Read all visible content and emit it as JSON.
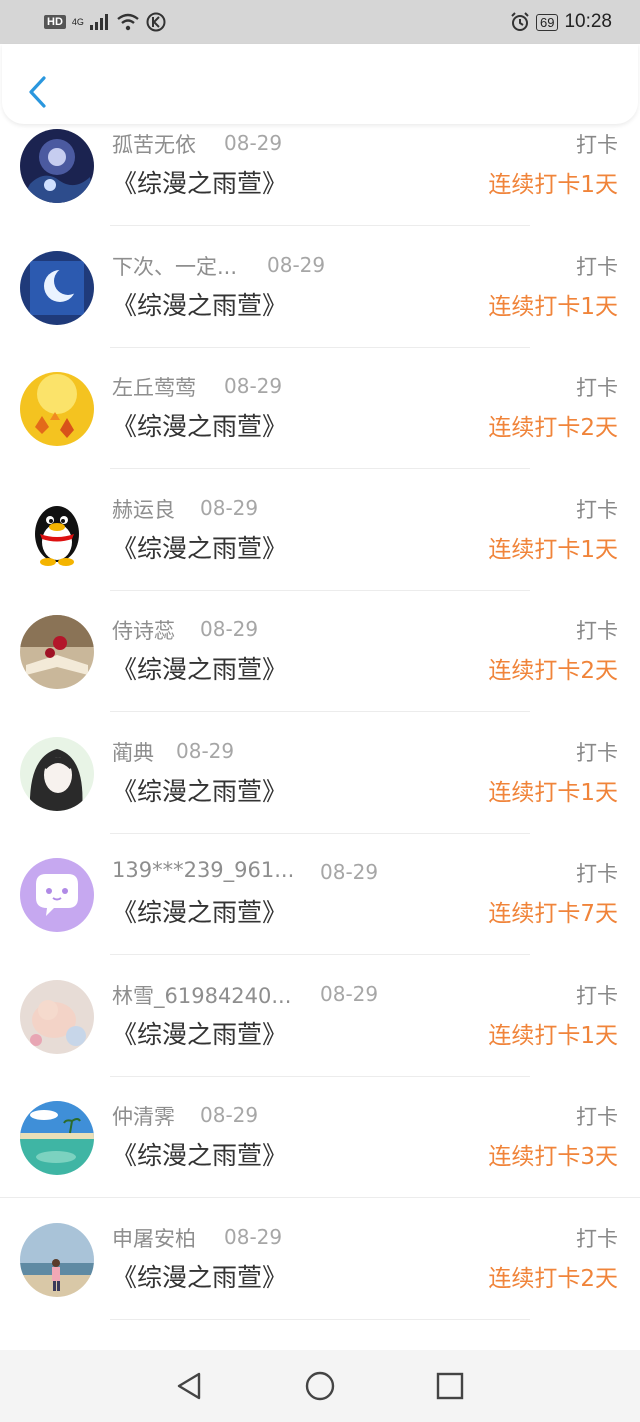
{
  "status_bar": {
    "hd": "HD",
    "network": "4G",
    "battery": "69",
    "time": "10:28",
    "icons": [
      "hd-icon",
      "signal-icon",
      "wifi-icon",
      "k-icon",
      "alarm-icon",
      "battery-icon"
    ]
  },
  "header": {
    "back_icon": "back-arrow-icon"
  },
  "colors": {
    "accent_orange": "#f0843a",
    "back_blue": "#2a97de"
  },
  "items": [
    {
      "name": "孤苦无依",
      "date": "08-29",
      "title": "《综漫之雨萱》",
      "tag": "打卡",
      "streak": "连续打卡1天",
      "avatar": "galaxy-avatar"
    },
    {
      "name": "下次、一定...",
      "date": "08-29",
      "title": "《综漫之雨萱》",
      "tag": "打卡",
      "streak": "连续打卡1天",
      "avatar": "moon-avatar"
    },
    {
      "name": "左丘莺莺",
      "date": "08-29",
      "title": "《综漫之雨萱》",
      "tag": "打卡",
      "streak": "连续打卡2天",
      "avatar": "autumn-leaves-avatar"
    },
    {
      "name": "赫运良",
      "date": "08-29",
      "title": "《综漫之雨萱》",
      "tag": "打卡",
      "streak": "连续打卡1天",
      "avatar": "penguin-avatar"
    },
    {
      "name": "侍诗蕊",
      "date": "08-29",
      "title": "《综漫之雨萱》",
      "tag": "打卡",
      "streak": "连续打卡2天",
      "avatar": "rose-book-avatar"
    },
    {
      "name": "蔺典",
      "date": "08-29",
      "title": "《综漫之雨萱》",
      "tag": "打卡",
      "streak": "连续打卡1天",
      "avatar": "anime-girl-avatar"
    },
    {
      "name": "139***239_961...",
      "date": "08-29",
      "title": "《综漫之雨萱》",
      "tag": "打卡",
      "streak": "连续打卡7天",
      "avatar": "chat-bubble-avatar"
    },
    {
      "name": "林雪_61984240...",
      "date": "08-29",
      "title": "《综漫之雨萱》",
      "tag": "打卡",
      "streak": "连续打卡1天",
      "avatar": "baby-avatar"
    },
    {
      "name": "仲清霁",
      "date": "08-29",
      "title": "《综漫之雨萱》",
      "tag": "打卡",
      "streak": "连续打卡3天",
      "avatar": "beach-avatar"
    },
    {
      "name": "申屠安柏",
      "date": "08-29",
      "title": "《综漫之雨萱》",
      "tag": "打卡",
      "streak": "连续打卡2天",
      "avatar": "seaside-person-avatar"
    }
  ],
  "nav": {
    "back": "nav-back-icon",
    "home": "nav-home-icon",
    "recents": "nav-recents-icon"
  }
}
